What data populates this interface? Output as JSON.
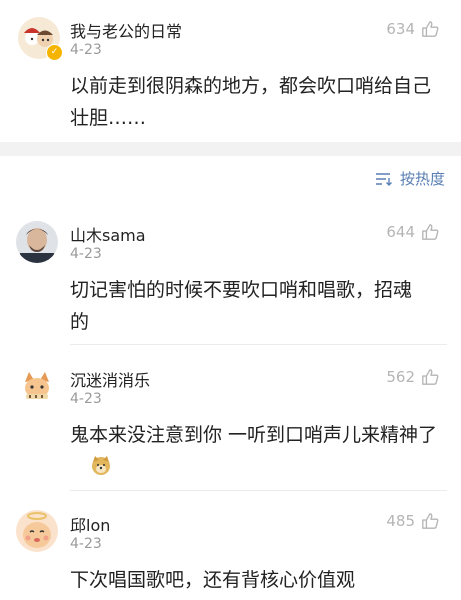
{
  "top_post": {
    "username": "我与老公的日常",
    "date": "4-23",
    "likes": "634",
    "text": "以前走到很阴森的地方，都会吹口哨给自己壮胆……",
    "verified_icon": "verified-badge-icon"
  },
  "sort": {
    "label": "按热度",
    "icon": "sort-icon"
  },
  "comments": [
    {
      "username": "山木sama",
      "date": "4-23",
      "likes": "644",
      "text": "切记害怕的时候不要吹口哨和唱歌，招魂的"
    },
    {
      "username": "沉迷消消乐",
      "date": "4-23",
      "likes": "562",
      "text": "鬼本来没注意到你 一听到口哨声儿来精神了"
    },
    {
      "username": "邱lon",
      "date": "4-23",
      "likes": "485",
      "text": "下次唱国歌吧，还有背核心价值观"
    }
  ],
  "colors": {
    "accent": "#5a7fb3",
    "muted": "#9a9a9a",
    "divider": "#f2f2f2",
    "badge": "#f4b400"
  }
}
